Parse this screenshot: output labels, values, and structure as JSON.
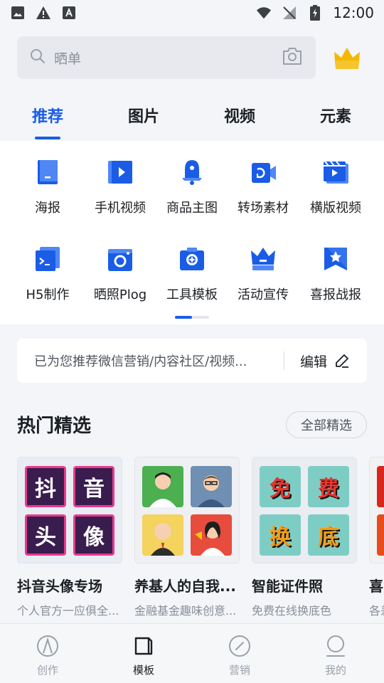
{
  "status_bar": {
    "time": "12:00"
  },
  "search": {
    "placeholder": "晒单"
  },
  "tabs": [
    {
      "label": "推荐",
      "active": true
    },
    {
      "label": "图片"
    },
    {
      "label": "视频"
    },
    {
      "label": "元素"
    }
  ],
  "categories": [
    {
      "label": "海报",
      "icon": "poster-icon"
    },
    {
      "label": "手机视频",
      "icon": "phone-video-icon"
    },
    {
      "label": "商品主图",
      "icon": "product-image-icon"
    },
    {
      "label": "转场素材",
      "icon": "transition-icon"
    },
    {
      "label": "横版视频",
      "icon": "landscape-video-icon"
    },
    {
      "label": "H5制作",
      "icon": "h5-icon"
    },
    {
      "label": "晒照Plog",
      "icon": "plog-icon"
    },
    {
      "label": "工具模板",
      "icon": "tool-template-icon"
    },
    {
      "label": "活动宣传",
      "icon": "promo-icon"
    },
    {
      "label": "喜报战报",
      "icon": "good-news-icon"
    }
  ],
  "recommend": {
    "text": "已为您推荐微信营销/内容社区/视频...",
    "edit_label": "编辑"
  },
  "section": {
    "title": "热门精选",
    "all_label": "全部精选"
  },
  "cards": [
    {
      "title": "抖音头像专场",
      "subtitle": "个人官方一应俱全...",
      "tiles": [
        "抖",
        "音",
        "头",
        "像"
      ]
    },
    {
      "title": "养基人的自我...",
      "subtitle": "金融基金趣味创意..."
    },
    {
      "title": "智能证件照",
      "subtitle": "免费在线换底色",
      "tiles": [
        "免",
        "费",
        "换",
        "底"
      ]
    },
    {
      "title": "喜",
      "subtitle": "各差"
    }
  ],
  "bottom_nav": [
    {
      "label": "创作",
      "icon": "create-icon"
    },
    {
      "label": "模板",
      "icon": "template-icon",
      "active": true
    },
    {
      "label": "营销",
      "icon": "marketing-icon"
    },
    {
      "label": "我的",
      "icon": "profile-icon"
    }
  ],
  "colors": {
    "accent": "#1a5ce6",
    "crown": "#f5b800"
  }
}
